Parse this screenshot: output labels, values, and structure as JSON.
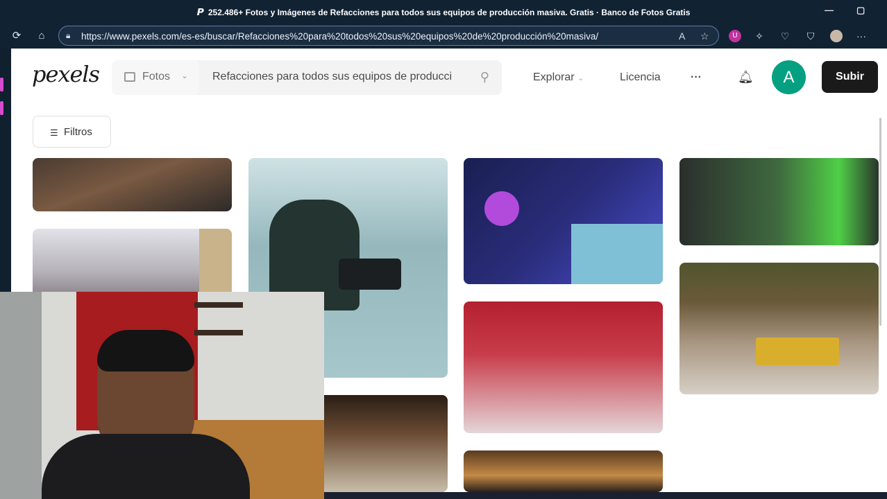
{
  "browser": {
    "window_title": "252.486+ Fotos y Imágenes de Refacciones para todos sus equipos de producción masiva. Gratis · Banco de Fotos Gratis",
    "url": "https://www.pexels.com/es-es/buscar/Refacciones%20para%20todos%20sus%20equipos%20de%20producción%20masiva/",
    "controls": {
      "minimize": "—",
      "restore": "▢"
    },
    "nav_icons": [
      "reload-icon",
      "home-icon"
    ],
    "extension_icons": [
      "read-aloud-icon",
      "favorite-icon",
      "shield-ext-icon",
      "extensions-icon",
      "heart-pulse-icon",
      "browser-essentials-icon",
      "profile-avatar",
      "more-icon"
    ]
  },
  "header": {
    "logo": "pexels",
    "search_type": "Fotos",
    "search_query": "Refacciones para todos sus equipos de producción masiva",
    "nav": {
      "explore": "Explorar",
      "license": "Licencia",
      "more": "···"
    },
    "avatar_letter": "A",
    "upload": "Subir"
  },
  "filters": {
    "label": "Filtros"
  },
  "gallery": {
    "photos": [
      {
        "name": "photo-workshop-bench",
        "colors": [
          "#3a3430",
          "#8a6a50"
        ]
      },
      {
        "name": "photo-factory-worker",
        "colors": [
          "#cfcfd5",
          "#7d7880"
        ]
      },
      {
        "name": "photo-cameraman-beach",
        "colors": [
          "#a6c3c8",
          "#2a3a38"
        ]
      },
      {
        "name": "photo-warehouse-hall",
        "colors": [
          "#3b2a1d",
          "#c9c0ae"
        ]
      },
      {
        "name": "photo-studio-console",
        "colors": [
          "#1a1f6e",
          "#c04ad8"
        ]
      },
      {
        "name": "photo-red-incense",
        "colors": [
          "#b4273a",
          "#e7d7d9"
        ]
      },
      {
        "name": "photo-workers-table",
        "colors": [
          "#3a2a1a",
          "#d49a4c"
        ]
      },
      {
        "name": "photo-tv-studio",
        "colors": [
          "#1f3f2a",
          "#55c94b"
        ]
      },
      {
        "name": "photo-quarry-machine",
        "colors": [
          "#8d7d6c",
          "#d7b23c"
        ]
      }
    ]
  }
}
